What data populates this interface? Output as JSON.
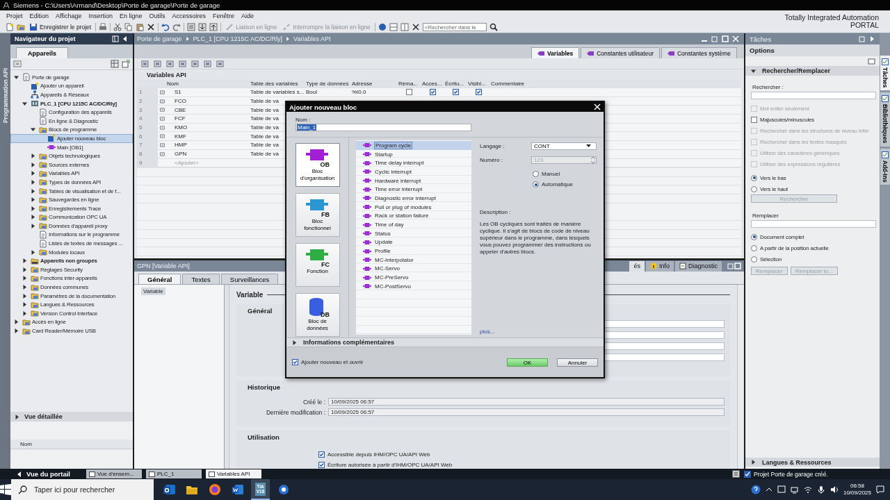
{
  "window": {
    "title": "Siemens  -  C:\\Users\\Armand\\Desktop\\Porte de garage\\Porte de garage"
  },
  "menu": [
    "Projet",
    "Edition",
    "Affichage",
    "Insertion",
    "En ligne",
    "Outils",
    "Accessoires",
    "Fenêtre",
    "Aide"
  ],
  "branding": {
    "line1": "Totally Integrated Automation",
    "line2": "PORTAL"
  },
  "toolbar": {
    "save_label": "Enregistrer le projet",
    "online": {
      "label": "Liaison en ligne",
      "disabled": true
    },
    "offline": {
      "label": "Interrompre la liaison en ligne",
      "disabled": true
    },
    "search": {
      "placeholder": "<Rechercher dans le"
    }
  },
  "side_strip": {
    "label": "Programmation API"
  },
  "navigator": {
    "title": "Navigateur du projet",
    "tabs": [
      {
        "label": "Appareils",
        "selected": true
      }
    ],
    "tree": [
      {
        "label": "Porte de garage",
        "kind": "doc",
        "expanded": true,
        "selected": false,
        "children": [
          {
            "label": "Ajouter un appareil",
            "kind": "add",
            "selected": false
          },
          {
            "label": "Appareils & Réseaux",
            "kind": "network",
            "selected": false
          },
          {
            "label": "PLC_1 [CPU 1215C AC/DC/Rly]",
            "kind": "plc",
            "expanded": true,
            "selected": false,
            "children": [
              {
                "label": "Configuration des appareils",
                "kind": "doc",
                "selected": false
              },
              {
                "label": "En ligne & Diagnostic",
                "kind": "doc",
                "selected": false
              },
              {
                "label": "Blocs de programme",
                "kind": "folder",
                "expanded": true,
                "selected": false,
                "children": [
                  {
                    "label": "Ajouter nouveau bloc",
                    "kind": "add",
                    "selected": true
                  },
                  {
                    "label": "Main [OB1]",
                    "kind": "block",
                    "selected": false
                  }
                ]
              },
              {
                "label": "Objets technologiques",
                "kind": "folder",
                "expanded": false,
                "selected": false
              },
              {
                "label": "Sources externes",
                "kind": "folder",
                "expanded": false,
                "selected": false
              },
              {
                "label": "Variables API",
                "kind": "folder",
                "expanded": false,
                "selected": false
              },
              {
                "label": "Types de données API",
                "kind": "folder",
                "expanded": false,
                "selected": false
              },
              {
                "label": "Tables de visualisation et de f...",
                "kind": "folder",
                "expanded": false,
                "selected": false
              },
              {
                "label": "Sauvegardes en ligne",
                "kind": "folder",
                "expanded": false,
                "selected": false
              },
              {
                "label": "Enregistrements Trace",
                "kind": "folder",
                "expanded": false,
                "selected": false
              },
              {
                "label": "Communication OPC UA",
                "kind": "folder",
                "expanded": false,
                "selected": false
              },
              {
                "label": "Données d'appareil proxy",
                "kind": "folder",
                "expanded": false,
                "selected": false
              },
              {
                "label": "Informations sur le programme",
                "kind": "doc",
                "selected": false
              },
              {
                "label": "Listes de textes de messages ...",
                "kind": "doc",
                "selected": false
              },
              {
                "label": "Modules locaux",
                "kind": "folder",
                "expanded": false,
                "selected": false
              }
            ]
          },
          {
            "label": "Appareils non groupés",
            "kind": "group",
            "expanded": false,
            "selected": false
          },
          {
            "label": "Réglages Security",
            "kind": "folder",
            "expanded": false,
            "selected": false
          },
          {
            "label": "Fonctions inter-appareils",
            "kind": "folder",
            "expanded": false,
            "selected": false
          },
          {
            "label": "Données communes",
            "kind": "folder",
            "expanded": false,
            "selected": false
          },
          {
            "label": "Paramètres de la documentation",
            "kind": "folder",
            "expanded": false,
            "selected": false
          },
          {
            "label": "Langues & Ressources",
            "kind": "folder",
            "expanded": false,
            "selected": false
          },
          {
            "label": "Version Control Interface",
            "kind": "folder",
            "expanded": false,
            "selected": false
          }
        ]
      },
      {
        "label": "Accès en ligne",
        "kind": "folder",
        "expanded": false,
        "selected": false
      },
      {
        "label": "Card Reader/Mémoire USB",
        "kind": "folder",
        "expanded": false,
        "selected": false
      }
    ],
    "detail_view": {
      "title": "Vue détaillée",
      "columns": [
        "Nom"
      ]
    }
  },
  "editor": {
    "breadcrumb": [
      "Porte de garage",
      "PLC_1 [CPU 1215C AC/DC/Rly]",
      "Variables API"
    ],
    "tabs": [
      {
        "label": "Variables",
        "selected": true
      },
      {
        "label": "Constantes utilisateur",
        "selected": false
      },
      {
        "label": "Constantes système",
        "selected": false
      }
    ],
    "title": "Variables API",
    "table": {
      "columns": [
        "Nom",
        "Table des variables",
        "Type de données",
        "Adresse",
        "Réma...",
        "Acces...",
        "Écritu...",
        "Visibl...",
        "Commentaire"
      ],
      "rows": [
        {
          "index": "1",
          "name": "S1",
          "table": "Table de variables s...",
          "type": "Bool",
          "address": "%I0.0",
          "retain": false,
          "access": true,
          "write": true,
          "visible": true
        },
        {
          "index": "2",
          "name": "FCO",
          "table": "Table de va"
        },
        {
          "index": "3",
          "name": "CBE",
          "table": "Table de va"
        },
        {
          "index": "4",
          "name": "FCF",
          "table": "Table de va"
        },
        {
          "index": "5",
          "name": "KMO",
          "table": "Table de va"
        },
        {
          "index": "6",
          "name": "KMF",
          "table": "Table de va"
        },
        {
          "index": "7",
          "name": "HMP",
          "table": "Table de va"
        },
        {
          "index": "8",
          "name": "GPN",
          "table": "Table de va"
        }
      ],
      "add_row": {
        "index": "9",
        "label": "<Ajouter>"
      }
    }
  },
  "inspector": {
    "title": "GPN [Variable API]",
    "side_tabs": [
      {
        "label": "és",
        "selected": true
      },
      {
        "label": "Info",
        "selected": false
      },
      {
        "label": "Diagnostic",
        "selected": false
      }
    ],
    "tabs": [
      {
        "label": "Général",
        "selected": true
      },
      {
        "label": "Textes",
        "selected": false
      },
      {
        "label": "Surveillances",
        "selected": false
      }
    ],
    "nav": [
      {
        "label": "Variable",
        "selected": true
      }
    ],
    "heading": "Variable",
    "general": {
      "title": "Général"
    },
    "history": {
      "title": "Historique",
      "fields": [
        {
          "label": "Créé le :",
          "value": "10/09/2025 06:57"
        },
        {
          "label": "Dernière modification :",
          "value": "10/09/2025 06:57"
        }
      ]
    },
    "usage": {
      "title": "Utilisation",
      "options": [
        {
          "label": "Accessible depuis IHM/OPC UA/API Web",
          "checked": true
        },
        {
          "label": "Écriture autorisée à partir d'IHM/OPC UA/API Web",
          "checked": true
        }
      ]
    }
  },
  "tasks": {
    "title": "Tâches",
    "options_title": "Options",
    "section": {
      "title": "Rechercher/Remplacer",
      "expanded": true,
      "search_label": "Rechercher :",
      "options": [
        {
          "label": "Mot entier seulement",
          "checked": false,
          "disabled": true
        },
        {
          "label": "Majuscules/minuscules",
          "checked": false,
          "disabled": false
        },
        {
          "label": "Rechercher dans les structures de niveau infér",
          "checked": false,
          "disabled": true
        },
        {
          "label": "Rechercher dans les textes masqués",
          "checked": false,
          "disabled": true
        },
        {
          "label": "Utiliser des caractères génériques",
          "checked": false,
          "disabled": true
        },
        {
          "label": "Utiliser des expressions régulières",
          "checked": false,
          "disabled": true
        }
      ],
      "direction": [
        {
          "label": "Vers le bas",
          "selected": true
        },
        {
          "label": "Vers le haut",
          "selected": false
        }
      ],
      "search_button": {
        "label": "Rechercher",
        "disabled": true
      },
      "replace_label": "Remplacer",
      "scope": [
        {
          "label": "Document complet",
          "selected": true
        },
        {
          "label": "A partir de la position actuelle",
          "selected": false
        },
        {
          "label": "Sélection",
          "selected": false
        }
      ],
      "buttons": [
        {
          "label": "Remplacer",
          "disabled": true
        },
        {
          "label": "Remplacer to...",
          "disabled": true
        }
      ]
    },
    "bottom_section": {
      "title": "Langues & Ressources",
      "expanded": false
    }
  },
  "vertical_tabs": [
    {
      "label": "Tâches",
      "selected": true
    },
    {
      "label": "Bibliothèques",
      "selected": false
    },
    {
      "label": "Add-Ins",
      "selected": false
    }
  ],
  "dialog": {
    "title": "Ajouter nouveau bloc",
    "name_label": "Nom :",
    "name_value": "Main_1",
    "block_types": [
      {
        "badge": "OB",
        "label": "Bloc d'organisation",
        "selected": true,
        "color": "#a21fd6"
      },
      {
        "badge": "FB",
        "label": "Bloc fonctionnel",
        "selected": false,
        "color": "#2a96d2"
      },
      {
        "badge": "FC",
        "label": "Fonction",
        "selected": false,
        "color": "#2fae45"
      },
      {
        "badge": "DB",
        "label": "Bloc de données",
        "selected": false,
        "color": "#3a5ee0"
      }
    ],
    "ob_types": [
      {
        "label": "Program cycle",
        "selected": true
      },
      {
        "label": "Startup",
        "selected": false
      },
      {
        "label": "Time delay interrupt",
        "selected": false
      },
      {
        "label": "Cyclic interrupt",
        "selected": false
      },
      {
        "label": "Hardware interrupt",
        "selected": false
      },
      {
        "label": "Time error interrupt",
        "selected": false
      },
      {
        "label": "Diagnostic error interrupt",
        "selected": false
      },
      {
        "label": "Pull or plug of modules",
        "selected": false
      },
      {
        "label": "Rack or station failure",
        "selected": false
      },
      {
        "label": "Time of day",
        "selected": false
      },
      {
        "label": "Status",
        "selected": false
      },
      {
        "label": "Update",
        "selected": false
      },
      {
        "label": "Profile",
        "selected": false
      },
      {
        "label": "MC-Interpolator",
        "selected": false
      },
      {
        "label": "MC-Servo",
        "selected": false
      },
      {
        "label": "MC-PreServo",
        "selected": false
      },
      {
        "label": "MC-PostServo",
        "selected": false
      }
    ],
    "language": {
      "label": "Langage :",
      "value": "CONT"
    },
    "number": {
      "label": "Numéro :",
      "value": "123",
      "disabled": true
    },
    "number_mode": [
      {
        "label": "Manuel",
        "selected": false
      },
      {
        "label": "Automatique",
        "selected": true
      }
    ],
    "description_label": "Description :",
    "description": "Les OB cycliques sont traités de manière cyclique. Il s'agit de blocs de code de niveau supérieur dans le programme, dans lesquels vous pouvez programmer des instructions ou appeler d'autres blocs.",
    "more_link": "plus...",
    "extra_section": {
      "title": "Informations complémentaires",
      "expanded": false
    },
    "open_after": {
      "label": "Ajouter nouveau et ouvrir",
      "checked": true
    },
    "buttons": [
      {
        "kind": "primary",
        "label": "OK"
      },
      {
        "kind": "secondary",
        "label": "Annuler"
      }
    ]
  },
  "status_bar": {
    "portal_label": "Vue du portail",
    "tabs": [
      {
        "label": "Vue d'ensem...",
        "selected": false
      },
      {
        "label": "PLC_1",
        "selected": false
      },
      {
        "label": "Variables API",
        "selected": true
      }
    ],
    "message": "Projet Porte de garage créé."
  },
  "taskbar": {
    "search_placeholder": "Taper ici pour rechercher",
    "apps": [
      {
        "kind": "mail",
        "selected": false
      },
      {
        "kind": "folder",
        "selected": false
      },
      {
        "kind": "browser",
        "selected": false
      },
      {
        "kind": "word",
        "selected": false
      },
      {
        "kind": "tia",
        "label": "TIA",
        "sublabel": "V18",
        "selected": true
      },
      {
        "kind": "gear",
        "selected": false
      }
    ],
    "time": "06:58",
    "date": "10/09/2025"
  }
}
